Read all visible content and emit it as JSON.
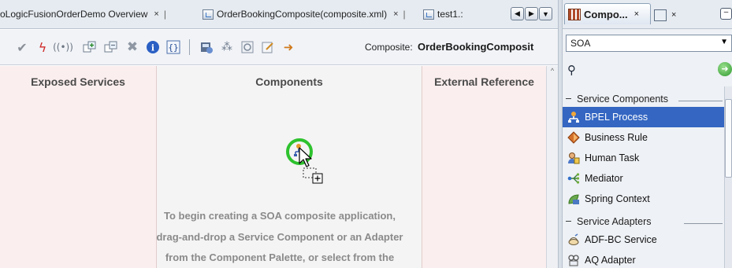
{
  "editor_tabs": [
    {
      "label": "oLogicFusionOrderDemo Overview",
      "close": "×"
    },
    {
      "label": "OrderBookingComposite(composite.xml)",
      "close": "×"
    },
    {
      "label": "test1.:",
      "close": ""
    }
  ],
  "toolbar": {
    "composite_label": "Composite:",
    "composite_name": "OrderBookingComposit"
  },
  "canvas": {
    "lanes": {
      "exposed": "Exposed Services",
      "components": "Components",
      "references": "External Reference"
    },
    "hint": [
      "To begin creating a SOA composite application,",
      "drag-and-drop a Service Component or an Adapter",
      "from the Component Palette, or select from the"
    ]
  },
  "palette": {
    "tab_title": "Compo...",
    "tab_close": "×",
    "props_close": "×",
    "selected_page": "SOA",
    "sections": [
      {
        "title": "Service Components",
        "items": [
          "BPEL Process",
          "Business Rule",
          "Human Task",
          "Mediator",
          "Spring Context"
        ]
      },
      {
        "title": "Service Adapters",
        "items": [
          "ADF-BC Service",
          "AQ Adapter"
        ]
      }
    ],
    "selected_item": "BPEL Process"
  }
}
